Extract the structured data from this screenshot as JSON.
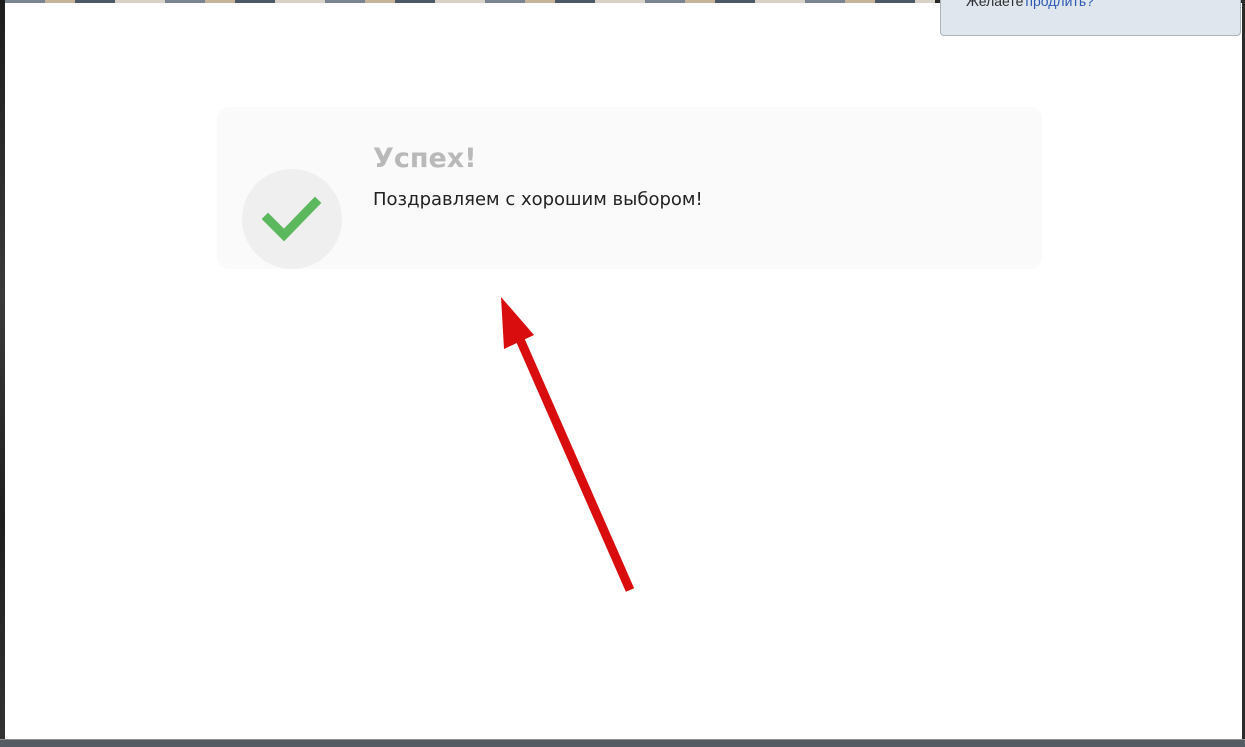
{
  "notification": {
    "text": "Желаете",
    "link_label": "продлить?"
  },
  "success_card": {
    "icon": "checkmark-icon",
    "title": "Успех!",
    "message": "Поздравляем с хорошим выбором!"
  },
  "colors": {
    "check_green": "#5cb85c",
    "arrow_red": "#d90d0d",
    "title_gray": "#b9b9b9"
  }
}
